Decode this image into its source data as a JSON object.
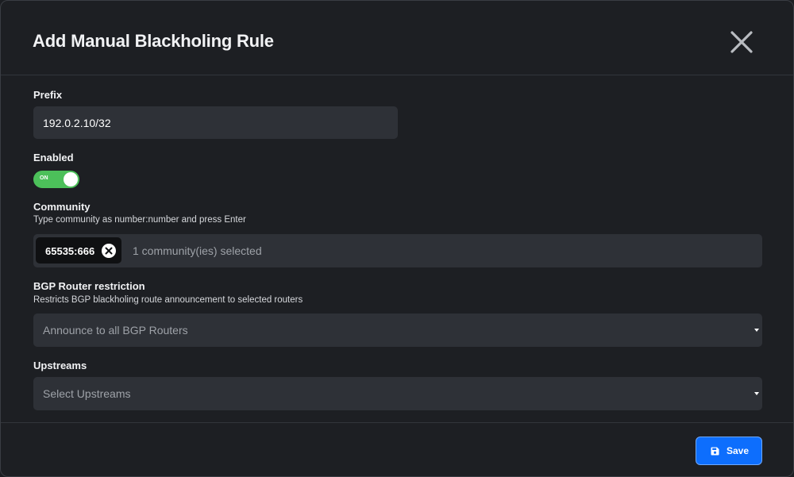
{
  "modal": {
    "title": "Add Manual Blackholing Rule",
    "close_icon": "close-icon"
  },
  "prefix": {
    "label": "Prefix",
    "value": "192.0.2.10/32"
  },
  "enabled": {
    "label": "Enabled",
    "toggle_text": "ON",
    "state": true
  },
  "community": {
    "label": "Community",
    "help": "Type community as number:number and press Enter",
    "tags": [
      "65535:666"
    ],
    "summary": "1 community(ies) selected"
  },
  "bgp_router": {
    "label": "BGP Router restriction",
    "help": "Restricts BGP blackholing route announcement to selected routers",
    "placeholder": "Announce to all BGP Routers"
  },
  "upstreams": {
    "label": "Upstreams",
    "placeholder": "Select Upstreams"
  },
  "footer": {
    "save_label": "Save",
    "save_icon": "floppy-disk-icon"
  },
  "colors": {
    "background": "#1d1f23",
    "input_bg": "#2e3137",
    "toggle_on": "#4cc05a",
    "primary": "#0d6efd"
  }
}
